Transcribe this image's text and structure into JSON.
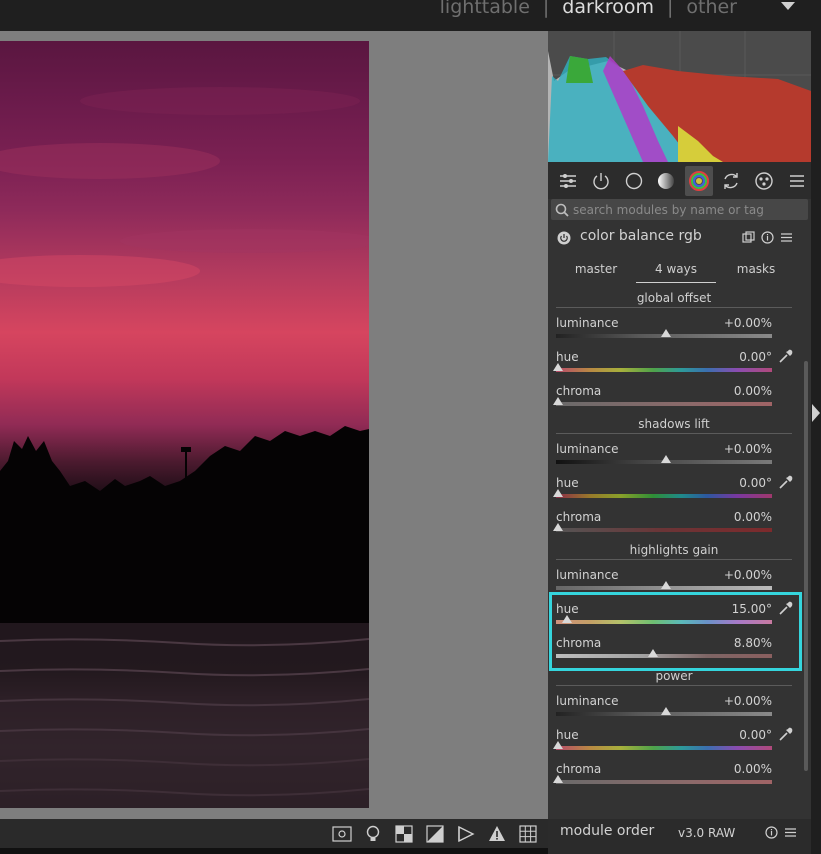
{
  "views": {
    "items": [
      "lighttable",
      "darkroom",
      "other"
    ],
    "separator": "|",
    "active": "darkroom"
  },
  "search": {
    "placeholder": "search modules by name or tag"
  },
  "module": {
    "title": "color balance rgb",
    "tabs": [
      "master",
      "4 ways",
      "masks"
    ],
    "active_tab": "4 ways",
    "sections": [
      {
        "title": "global offset",
        "sliders": [
          {
            "label": "luminance",
            "value": "+0.00%",
            "position": 0.5
          },
          {
            "label": "hue",
            "value": "0.00°",
            "position": 0.0
          },
          {
            "label": "chroma",
            "value": "0.00%",
            "position": 0.0
          }
        ]
      },
      {
        "title": "shadows lift",
        "sliders": [
          {
            "label": "luminance",
            "value": "+0.00%",
            "position": 0.5
          },
          {
            "label": "hue",
            "value": "0.00°",
            "position": 0.0
          },
          {
            "label": "chroma",
            "value": "0.00%",
            "position": 0.0
          }
        ]
      },
      {
        "title": "highlights gain",
        "sliders": [
          {
            "label": "luminance",
            "value": "+0.00%",
            "position": 0.5
          },
          {
            "label": "hue",
            "value": "15.00°",
            "position": 0.04
          },
          {
            "label": "chroma",
            "value": "8.80%",
            "position": 0.44
          }
        ]
      },
      {
        "title": "power",
        "sliders": [
          {
            "label": "luminance",
            "value": "+0.00%",
            "position": 0.5
          },
          {
            "label": "hue",
            "value": "0.00°",
            "position": 0.0
          },
          {
            "label": "chroma",
            "value": "0.00%",
            "position": 0.0
          }
        ]
      }
    ]
  },
  "footer": {
    "module_order_label": "module order",
    "version": "v3.0 RAW"
  },
  "colors": {
    "highlight": "#35d5dd",
    "panel": "#333333",
    "canvas": "#7e7e7e"
  }
}
